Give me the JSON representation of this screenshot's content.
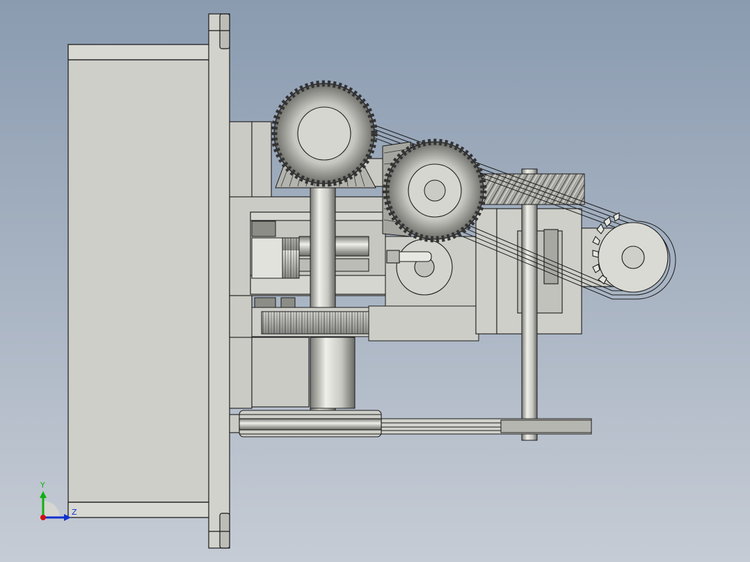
{
  "scene": {
    "description_type": "cad-mechanical-assembly",
    "colors": {
      "bg_top": "#8c9cb0",
      "bg_bottom": "#c2c9d3",
      "metal_light": "#d8d8d2",
      "metal_mid": "#b4b4ae",
      "metal_dark": "#6e6e6a",
      "outline": "#1a1a1a",
      "axis_x": "#d01010",
      "axis_y": "#10b010",
      "axis_z": "#1030d0"
    }
  },
  "triad": {
    "y_label": "Y",
    "z_label": "Z"
  }
}
